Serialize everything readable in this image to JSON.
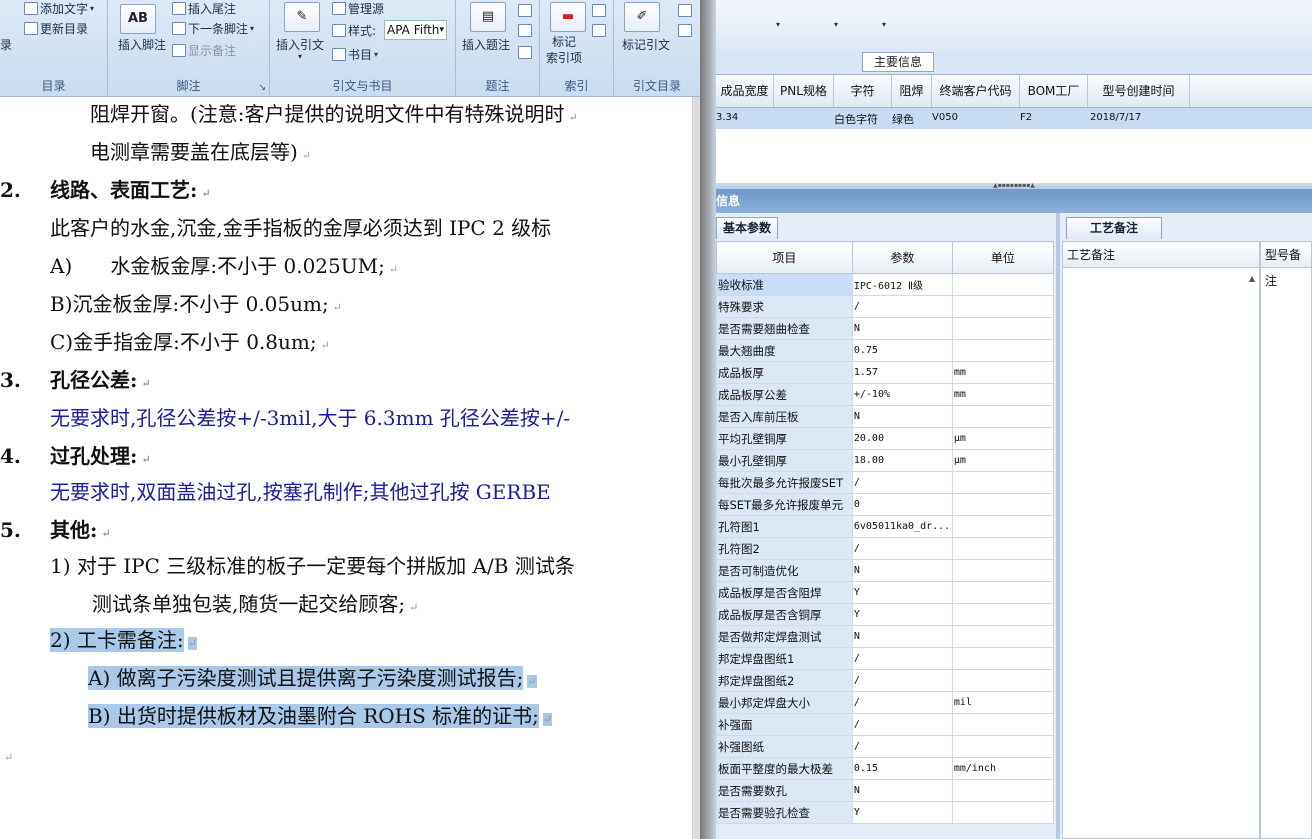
{
  "ribbon": {
    "toc_group": {
      "add_text": "添加文字",
      "update_toc": "更新目录",
      "partial_label": "录",
      "label": "目录"
    },
    "footnote_group": {
      "insert_footnote": "插入脚注",
      "ab_icon_text": "AB",
      "insert_endnote": "插入尾注",
      "next_footnote": "下一条脚注",
      "show_notes": "显示备注",
      "label": "脚注"
    },
    "citation_group": {
      "insert_citation": "插入引文",
      "manage_sources": "管理源",
      "style_label": "样式:",
      "style_value": "APA Fifth",
      "bibliography": "书目",
      "label": "引文与书目"
    },
    "caption_group": {
      "insert_caption": "插入题注",
      "label": "题注"
    },
    "index_group": {
      "mark_entry": "标记\n索引项",
      "label": "索引"
    },
    "toa_group": {
      "mark_citation": "标记引文",
      "label": "引文目录"
    }
  },
  "document": {
    "lines": [
      {
        "text": "阻焊开窗。(注意:客户提供的说明文件中有特殊说明时",
        "style": "normal"
      },
      {
        "text": "电测章需要盖在底层等)",
        "style": "normal"
      },
      {
        "num": "2.",
        "text": "线路、表面工艺:",
        "style": "heading"
      },
      {
        "text": "此客户的水金,沉金,金手指板的金厚必须达到 IPC 2 级标",
        "style": "normal"
      },
      {
        "text": "A)      水金板金厚:不小于 0.025UM;",
        "style": "normal"
      },
      {
        "text": "B)沉金板金厚:不小于 0.05um;",
        "style": "normal"
      },
      {
        "text": "C)金手指金厚:不小于 0.8um;",
        "style": "normal"
      },
      {
        "num": "3.",
        "text": "孔径公差:",
        "style": "heading"
      },
      {
        "text": "无要求时,孔径公差按+/-3mil,大于 6.3mm 孔径公差按+/-",
        "style": "blue"
      },
      {
        "num": "4.",
        "text": "过孔处理:",
        "style": "heading"
      },
      {
        "text": "无要求时,双面盖油过孔,按塞孔制作;其他过孔按 GERBE",
        "style": "blue"
      },
      {
        "num": "5.",
        "text": "其他:",
        "style": "heading"
      },
      {
        "text": "1) 对于 IPC 三级标准的板子一定要每个拼版加 A/B 测试条",
        "style": "normal"
      },
      {
        "text": "测试条单独包装,随货一起交给顾客;",
        "style": "normal"
      },
      {
        "text": "2) 工卡需备注:",
        "style": "highlight"
      },
      {
        "text": "A) 做离子污染度测试且提供离子污染度测试报告;",
        "style": "highlight"
      },
      {
        "text": "B) 出货时提供板材及油墨附合 ROHS 标准的证书;",
        "style": "highlight"
      }
    ],
    "end_mark": "↵"
  },
  "app": {
    "main_info_label": "主要信息",
    "columns": [
      "成品宽度",
      "PNL规格",
      "字符",
      "阻焊",
      "终端客户代码",
      "BOM工厂",
      "型号创建时间"
    ],
    "selected_row": [
      "3.34",
      "",
      "白色字符",
      "绿色",
      "V050",
      "F2",
      "2018/7/17"
    ],
    "info_bar": "信息",
    "left_tab": "基本参数",
    "right_tab": "工艺备注",
    "param_headers": [
      "项目",
      "参数",
      "单位"
    ],
    "params": [
      {
        "k": "验收标准",
        "v": "IPC-6012 Ⅱ级",
        "u": ""
      },
      {
        "k": "特殊要求",
        "v": "/",
        "u": ""
      },
      {
        "k": "是否需要翘曲检查",
        "v": "N",
        "u": ""
      },
      {
        "k": "最大翘曲度",
        "v": "0.75",
        "u": ""
      },
      {
        "k": "成品板厚",
        "v": "1.57",
        "u": "mm"
      },
      {
        "k": "成品板厚公差",
        "v": "+/-10%",
        "u": "mm"
      },
      {
        "k": "是否入库前压板",
        "v": "N",
        "u": ""
      },
      {
        "k": "平均孔壁铜厚",
        "v": "20.00",
        "u": "μm"
      },
      {
        "k": "最小孔壁铜厚",
        "v": "18.00",
        "u": "μm"
      },
      {
        "k": "每批次最多允许报废SET",
        "v": "/",
        "u": ""
      },
      {
        "k": "每SET最多允许报废单元",
        "v": "0",
        "u": ""
      },
      {
        "k": "孔符图1",
        "v": "6v05011ka0_dr...",
        "u": ""
      },
      {
        "k": "孔符图2",
        "v": "/",
        "u": ""
      },
      {
        "k": "是否可制造优化",
        "v": "N",
        "u": ""
      },
      {
        "k": "成品板厚是否含阻焊",
        "v": "Y",
        "u": ""
      },
      {
        "k": "成品板厚是否含铜厚",
        "v": "Y",
        "u": ""
      },
      {
        "k": "是否做邦定焊盘测试",
        "v": "N",
        "u": ""
      },
      {
        "k": "邦定焊盘图纸1",
        "v": "/",
        "u": ""
      },
      {
        "k": "邦定焊盘图纸2",
        "v": "/",
        "u": ""
      },
      {
        "k": "最小邦定焊盘大小",
        "v": "/",
        "u": "mil"
      },
      {
        "k": "补强面",
        "v": "/",
        "u": ""
      },
      {
        "k": "补强图纸",
        "v": "/",
        "u": ""
      },
      {
        "k": "板面平整度的最大极差",
        "v": "0.15",
        "u": "mm/inch"
      },
      {
        "k": "是否需要数孔",
        "v": "N",
        "u": ""
      },
      {
        "k": "是否需要验孔检查",
        "v": "Y",
        "u": ""
      }
    ],
    "process_note_header": "工艺备注",
    "model_note_header": "型号备注"
  }
}
